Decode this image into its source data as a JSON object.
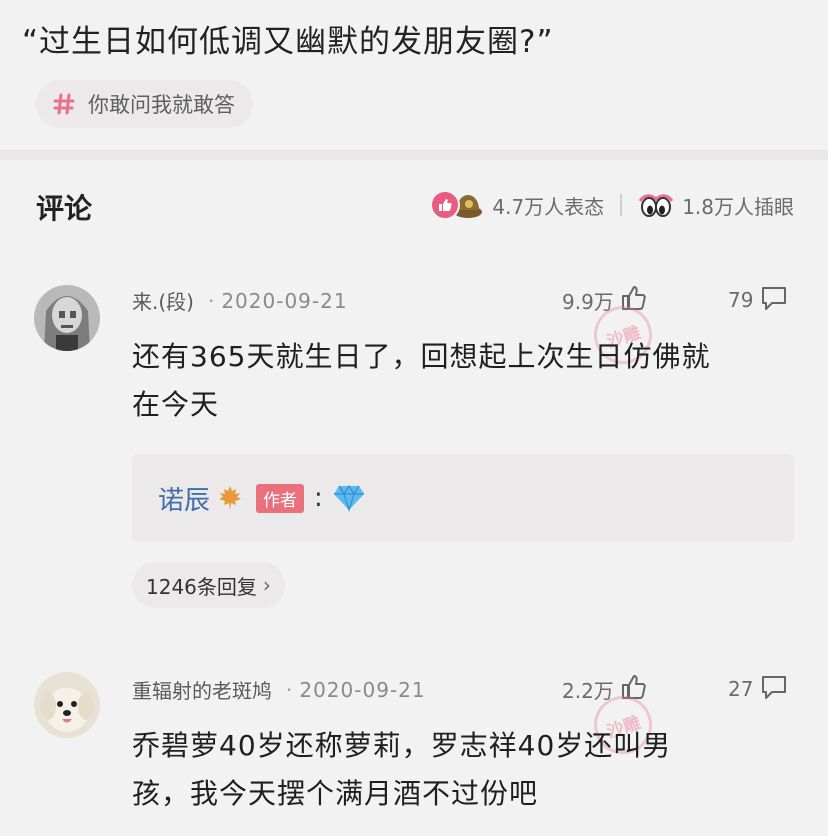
{
  "post": {
    "title": "“过生日如何低调又幽默的发朋友圈?”",
    "topic": "你敢问我就敢答"
  },
  "comments_header": {
    "title": "评论",
    "reactions_text": "4.7万人表态",
    "peek_text": "1.8万人插眼"
  },
  "comments": [
    {
      "username": "来.(段)",
      "date": "2020-09-21",
      "likes": "9.9万",
      "replies": "79",
      "text_line1": "还有365天就生日了，回想起上次生日仿佛就",
      "text_line2": "在今天",
      "reply_preview": {
        "name": "诺辰",
        "badge": "作者",
        "colon": ":"
      },
      "reply_count_label": "1246条回复",
      "watermark": "沙雕"
    },
    {
      "username": "重辐射的老斑鸠",
      "date": "2020-09-21",
      "likes": "2.2万",
      "replies": "27",
      "text_line1": "乔碧萝40岁还称萝莉，罗志祥40岁还叫男",
      "text_line2": "孩，我今天摆个满月酒不过份吧",
      "watermark": "沙雕"
    }
  ],
  "icons": {
    "topic": "hash-icon",
    "reaction_primary": "thumbs-up-icon",
    "reaction_secondary": "soldier-helmet-icon",
    "peek": "eyes-icon",
    "like": "thumbs-up-outline-icon",
    "reply": "comment-bubble-icon",
    "leaf": "maple-leaf-icon",
    "diamond": "diamond-icon"
  },
  "colors": {
    "accent_pink": "#e85b83",
    "author_badge": "#e9707c",
    "link_blue": "#3f6fa8",
    "background": "#f3f2f2"
  }
}
